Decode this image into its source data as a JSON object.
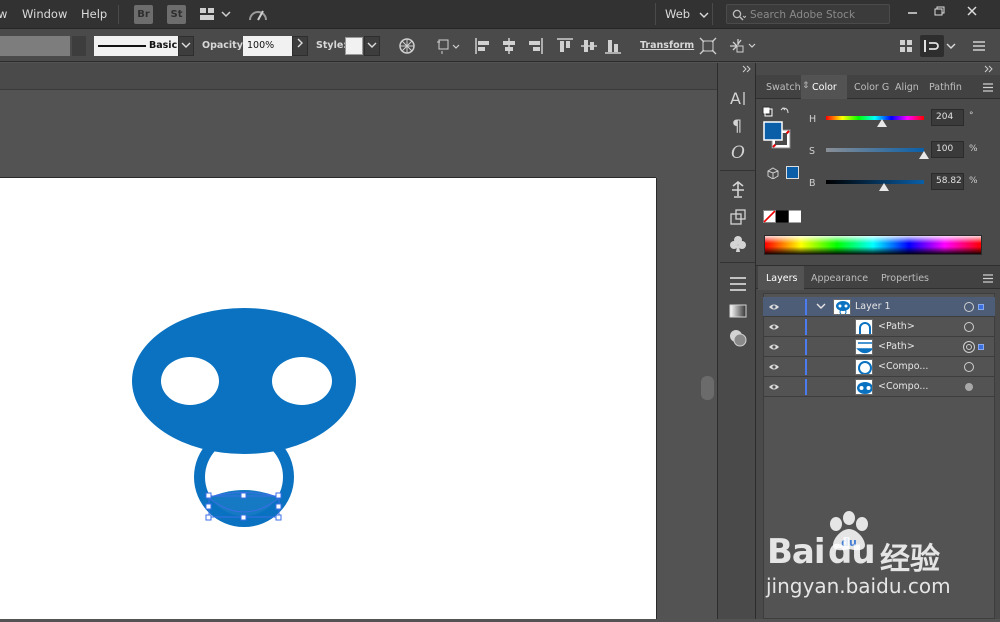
{
  "menubar": {
    "items": [
      "w",
      "Window",
      "Help"
    ],
    "bridge_badge": "Br",
    "stock_badge": "St",
    "workspace": "Web",
    "search_placeholder": "Search Adobe Stock"
  },
  "control_bar": {
    "stroke_profile": "Basic",
    "opacity_label": "Opacity:",
    "opacity_value": "100%",
    "style_label": "Style:",
    "transform_label": "Transform"
  },
  "color_panel": {
    "tabs": [
      "Swatch",
      "Color",
      "Color G",
      "Align",
      "Pathfin"
    ],
    "active_tab": "Color",
    "fill_color": "#0a5fa8",
    "h_label": "H",
    "h_value": "204",
    "h_unit": "°",
    "h_fraction": 0.567,
    "s_label": "S",
    "s_value": "100",
    "s_unit": "%",
    "s_fraction": 1.0,
    "b_label": "B",
    "b_value": "58.82",
    "b_unit": "%",
    "b_fraction": 0.588
  },
  "layers_panel": {
    "tabs": [
      "Layers",
      "Appearance",
      "Properties"
    ],
    "active_tab": "Layers",
    "rows": [
      {
        "name": "Layer 1",
        "indent": 0,
        "selected": true,
        "thumb": "face"
      },
      {
        "name": "<Path>",
        "indent": 1,
        "selected": false,
        "thumb": "arch"
      },
      {
        "name": "<Path>",
        "indent": 1,
        "selected": false,
        "thumb": "smile"
      },
      {
        "name": "<Compo...",
        "indent": 1,
        "selected": false,
        "thumb": "ring"
      },
      {
        "name": "<Compo...",
        "indent": 1,
        "selected": false,
        "thumb": "eyes"
      }
    ]
  },
  "canvas": {
    "shape_color": "#0a72c0"
  },
  "watermark": {
    "brand": "Bai",
    "brand_suffix": "du",
    "chinese": "经验",
    "url": "jingyan.baidu.com"
  }
}
